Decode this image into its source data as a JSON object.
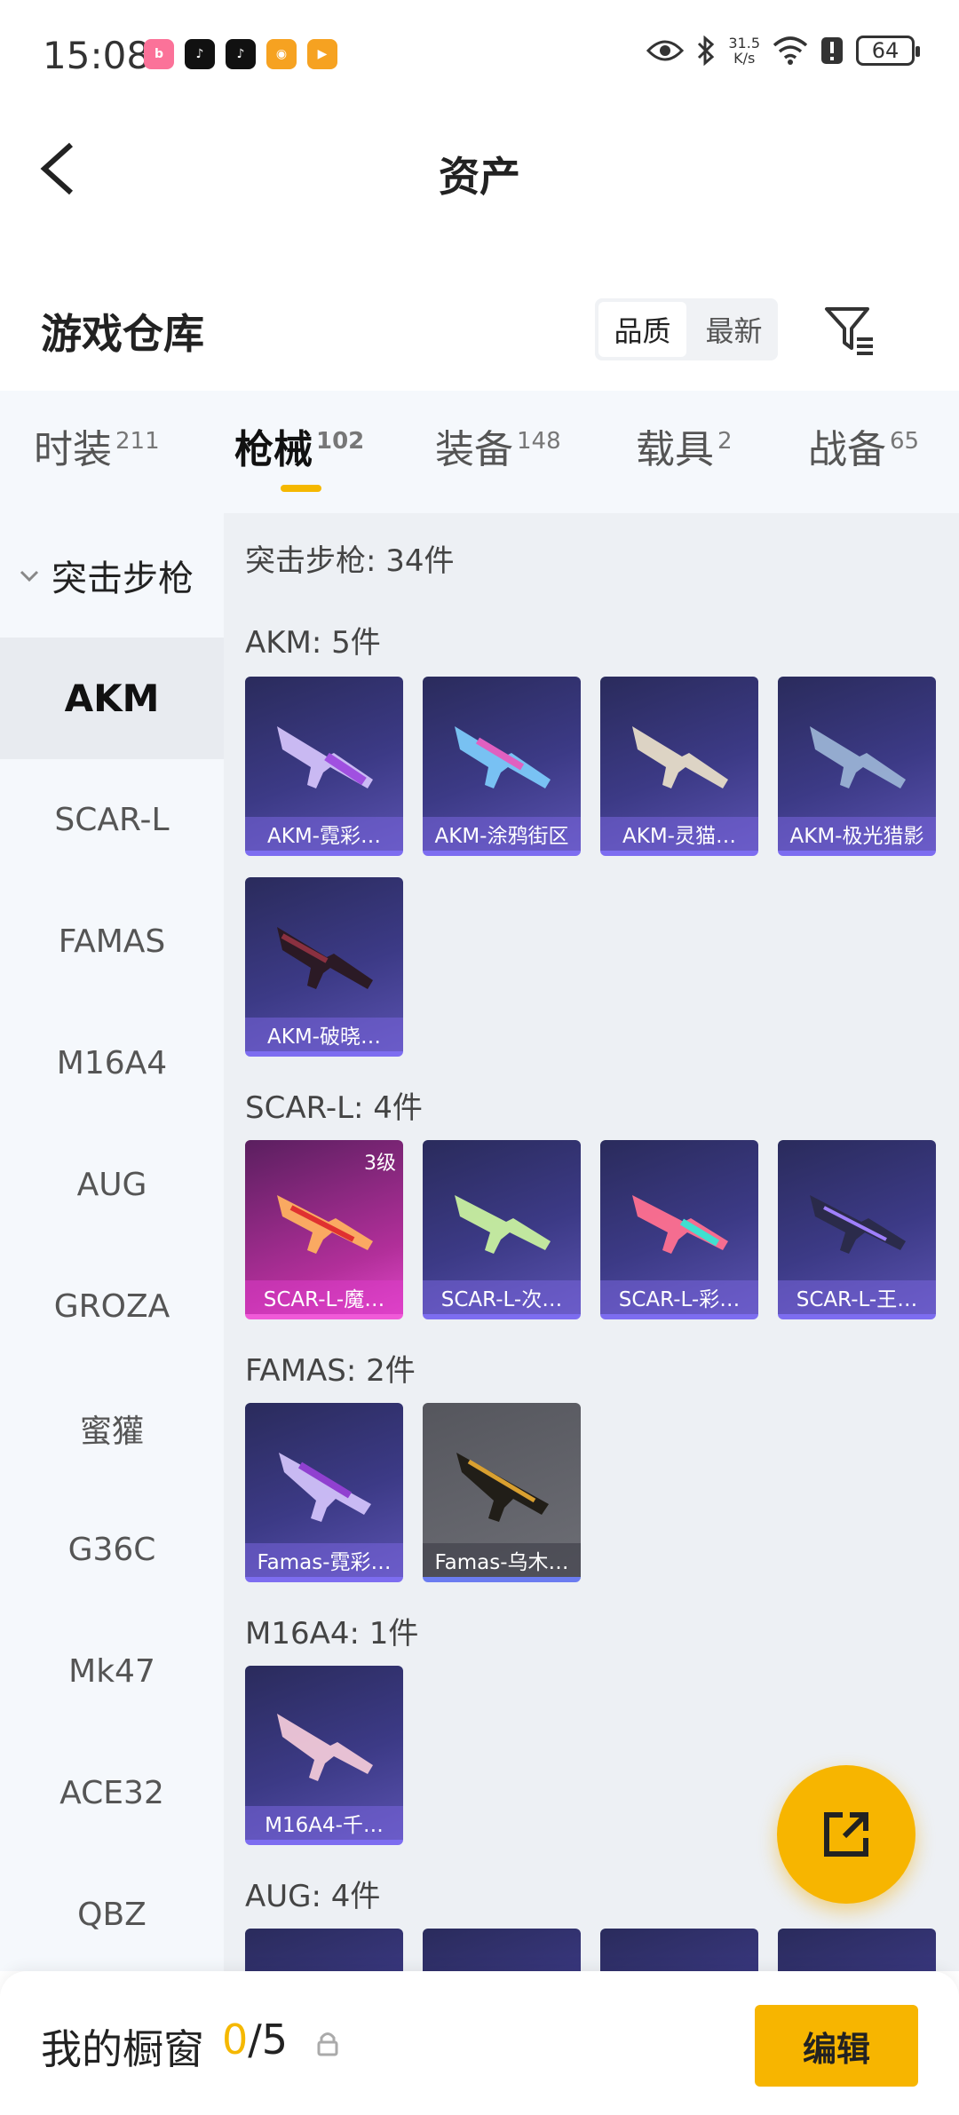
{
  "status_bar": {
    "time": "15:08",
    "apps": [
      {
        "icon": "bilibili-icon",
        "color": "#fb7299",
        "glyph": "b"
      },
      {
        "icon": "tiktok-icon",
        "color": "#111111",
        "glyph": "♪"
      },
      {
        "icon": "tiktok-icon",
        "color": "#111111",
        "glyph": "♪"
      },
      {
        "icon": "game-icon",
        "color": "#f6a221",
        "glyph": "◉"
      },
      {
        "icon": "play-icon",
        "color": "#f6a221",
        "glyph": "▶"
      }
    ],
    "net_speed_value": "31.5",
    "net_speed_unit": "K/s",
    "battery": "64"
  },
  "header": {
    "title": "资产"
  },
  "warehouse": {
    "title": "游戏仓库",
    "sort_options": [
      "品质",
      "最新"
    ],
    "active_sort": "品质"
  },
  "tabs": [
    {
      "label": "时装",
      "count": "211"
    },
    {
      "label": "枪械",
      "count": "102"
    },
    {
      "label": "装备",
      "count": "148"
    },
    {
      "label": "载具",
      "count": "2"
    },
    {
      "label": "战备",
      "count": "65"
    }
  ],
  "active_tab": "枪械",
  "sidebar": {
    "group": "突击步枪",
    "items": [
      "AKM",
      "SCAR-L",
      "FAMAS",
      "M16A4",
      "AUG",
      "GROZA",
      "蜜獾",
      "G36C",
      "Mk47",
      "ACE32",
      "QBZ"
    ],
    "active": "AKM"
  },
  "content": {
    "summary": "突击步枪: 34件",
    "sections": [
      {
        "title": "AKM: 5件",
        "items": [
          {
            "name": "AKM-霓彩…"
          },
          {
            "name": "AKM-涂鸦街区"
          },
          {
            "name": "AKM-灵猫…"
          },
          {
            "name": "AKM-极光猎影"
          },
          {
            "name": "AKM-破晓…"
          }
        ]
      },
      {
        "title": "SCAR-L: 4件",
        "items": [
          {
            "name": "SCAR-L-魔…",
            "level": "3级"
          },
          {
            "name": "SCAR-L-次…"
          },
          {
            "name": "SCAR-L-彩…"
          },
          {
            "name": "SCAR-L-王…"
          }
        ]
      },
      {
        "title": "FAMAS: 2件",
        "items": [
          {
            "name": "Famas-霓彩…"
          },
          {
            "name": "Famas-乌木…"
          }
        ]
      },
      {
        "title": "M16A4: 1件",
        "items": [
          {
            "name": "M16A4-千…"
          }
        ]
      },
      {
        "title": "AUG: 4件",
        "items": []
      }
    ]
  },
  "bottom_bar": {
    "title": "我的橱窗",
    "count_current": "0",
    "count_total": "/5",
    "edit_label": "编辑"
  },
  "colors": {
    "accent": "#f7b500",
    "card_purple": "#3c3a86",
    "card_pink": "#b22f9a",
    "card_gray": "#6d6e75"
  }
}
